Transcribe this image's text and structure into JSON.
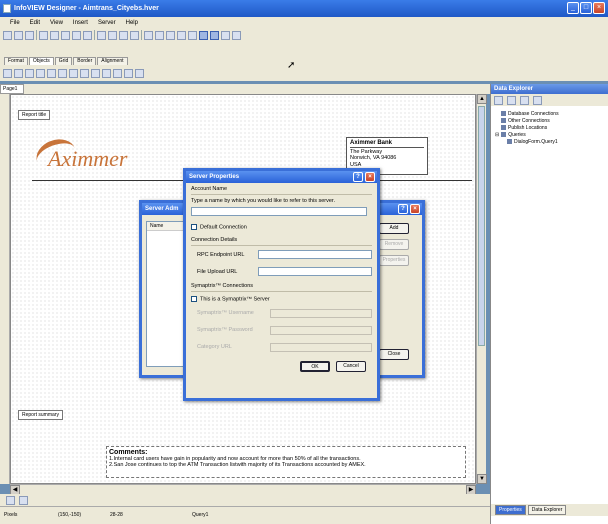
{
  "window": {
    "title": "InfoVIEW Designer - Aimtrans_Cityebs.hver"
  },
  "menu": [
    "File",
    "Edit",
    "View",
    "Insert",
    "Server",
    "Help"
  ],
  "format_tabs": [
    "Format",
    "Objects",
    "Grid",
    "Border",
    "Alignment"
  ],
  "page_tab": "Page1",
  "report": {
    "title_band": "Report title",
    "summary_band": "Report summary",
    "logo": "Aximmer",
    "bank": {
      "name": "Aximmer Bank",
      "line1": "The Parkway",
      "line2": "Norwich, VA 94086",
      "line3": "USA"
    },
    "comments_title": "Comments:",
    "comments": [
      "1.Internal card users have gain in popularity and now account for more than 50% of all the transactions.",
      "2.San Jose continues to top the ATM Transaction listwith majority of its Transactions accounted by AMEX."
    ]
  },
  "server_admin": {
    "title": "Server Adm",
    "column": "Name",
    "buttons": {
      "add": "Add",
      "remove": "Remove",
      "properties": "Properties",
      "close": "Close"
    }
  },
  "server_props": {
    "title": "Server Properties",
    "account_name": "Account Name",
    "account_hint": "Type a name by which you would like to refer to this server.",
    "default_connection": "Default Connection",
    "connection_details": "Connection Details",
    "rpc_url": "RPC Endpoint URL",
    "file_upload_url": "File Upload URL",
    "symaptrix_connections": "Symaptrix™ Connections",
    "symaptrix_server": "This is a Symaptrix™ Server",
    "symaptrix_username": "Symaptrix™ Username",
    "symaptrix_password": "Symaptrix™ Password",
    "category_url": "Category URL",
    "ok": "OK",
    "cancel": "Cancel"
  },
  "data_explorer": {
    "title": "Data Explorer",
    "tree": [
      "Database Connections",
      "Other Connections",
      "Publish Locations",
      "Queries",
      "DialogForm.Query1"
    ],
    "tabs": [
      "Properties",
      "Data Explorer"
    ]
  },
  "status": {
    "mode": "Pixels",
    "coords": "(150,-150)",
    "size": "28-28",
    "object": "Query1"
  }
}
